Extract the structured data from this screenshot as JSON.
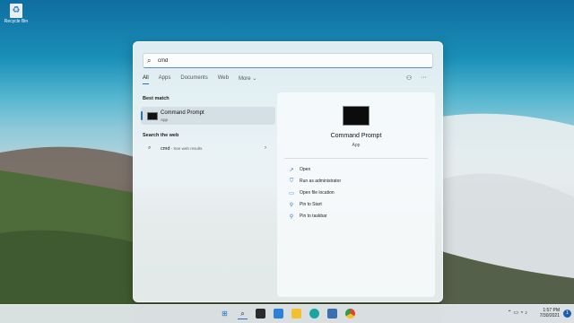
{
  "desktop": {
    "recycle_bin_label": "Recycle Bin"
  },
  "search": {
    "value": "cmd",
    "placeholder": ""
  },
  "tabs": [
    {
      "label": "All",
      "active": true
    },
    {
      "label": "Apps",
      "active": false
    },
    {
      "label": "Documents",
      "active": false
    },
    {
      "label": "Web",
      "active": false
    },
    {
      "label": "More",
      "active": false
    }
  ],
  "best_match": {
    "section_label": "Best match",
    "title": "Command Prompt",
    "subtitle": "App"
  },
  "web": {
    "section_label": "Search the web",
    "query": "cmd",
    "suffix": " - See web results"
  },
  "details": {
    "title": "Command Prompt",
    "subtitle": "App",
    "actions": [
      {
        "label": "Open",
        "icon": "open-icon"
      },
      {
        "label": "Run as administrator",
        "icon": "shield-icon"
      },
      {
        "label": "Open file location",
        "icon": "folder-icon"
      },
      {
        "label": "Pin to Start",
        "icon": "pin-icon"
      },
      {
        "label": "Pin to taskbar",
        "icon": "pin-icon"
      }
    ]
  },
  "taskbar": {
    "time": "1:57 PM",
    "date": "7/30/2021",
    "notifications": "1"
  },
  "colors": {
    "accent": "#2a6fc0"
  }
}
